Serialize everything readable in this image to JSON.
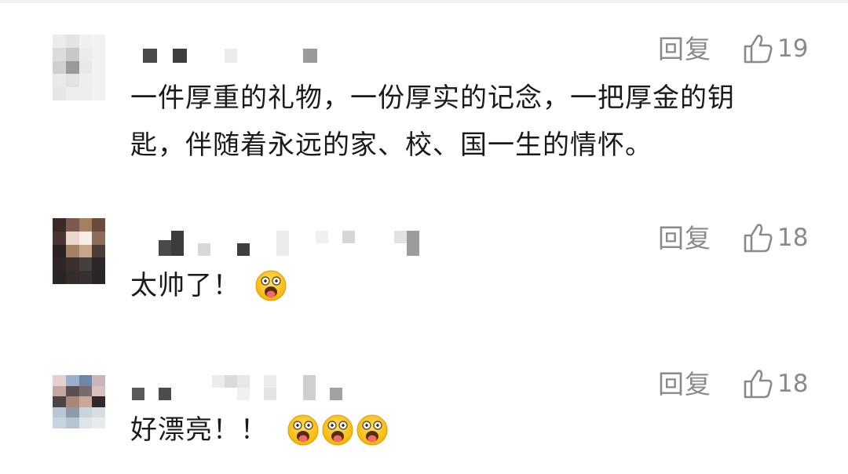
{
  "comments": [
    {
      "reply_label": "回复",
      "like_count": "19",
      "lines": [
        "一件厚重的礼物，一份厚实的记念，一把厚金的钥",
        "匙，伴随着永远的家、校、国一生的情怀。"
      ],
      "emoji_icon": "",
      "avatar_colors": [
        "#ececec",
        "#e4e4e4",
        "#f0f0f0",
        "#f2f2f2",
        "#dcdcdc",
        "#c8c8c8",
        "#ebebeb",
        "#f2f2f2",
        "#cfcfcf",
        "#9a9a9a",
        "#e8e8e8",
        "#f2f2f2",
        "#e9e9e9",
        "#e3e3e3",
        "#eeeeee",
        "#f2f2f2",
        "#e6e6e6",
        "#ededed",
        "#ededed",
        "#f2f2f2"
      ]
    },
    {
      "reply_label": "回复",
      "like_count": "18",
      "lines": [
        "太帅了！"
      ],
      "emoji_icon": "tongue-out-emoji-icon",
      "emoji_count": 1,
      "avatar_colors": [
        "#3a2a26",
        "#7d5a50",
        "#a47f62",
        "#6b4b3c",
        "#4a3530",
        "#e9d7d0",
        "#f7efe7",
        "#8e6c5c",
        "#2b2224",
        "#a58063",
        "#c9a58a",
        "#4c3d37",
        "#2e2627",
        "#3b302e",
        "#444040",
        "#2d2728",
        "#2b2526",
        "#342d2c",
        "#363030",
        "#2a2526"
      ]
    },
    {
      "reply_label": "回复",
      "like_count": "18",
      "lines": [
        "好漂亮！！"
      ],
      "emoji_icon": "tongue-out-emoji-icon",
      "emoji_count": 3,
      "avatar_colors": [
        "#e8cfcf",
        "#9ab0c8",
        "#6e87a8",
        "#c7b7b8",
        "#c2a89f",
        "#5a5050",
        "#7a6a6a",
        "#d9c2bd",
        "#4a4444",
        "#a88778",
        "#c9a798",
        "#2e2a2c",
        "#b7c7d8",
        "#8e99aa",
        "#c8d3de",
        "#d7dde3",
        "#c9d4de",
        "#b6c4d2",
        "#dde4ea",
        "#e6ebef"
      ]
    }
  ]
}
